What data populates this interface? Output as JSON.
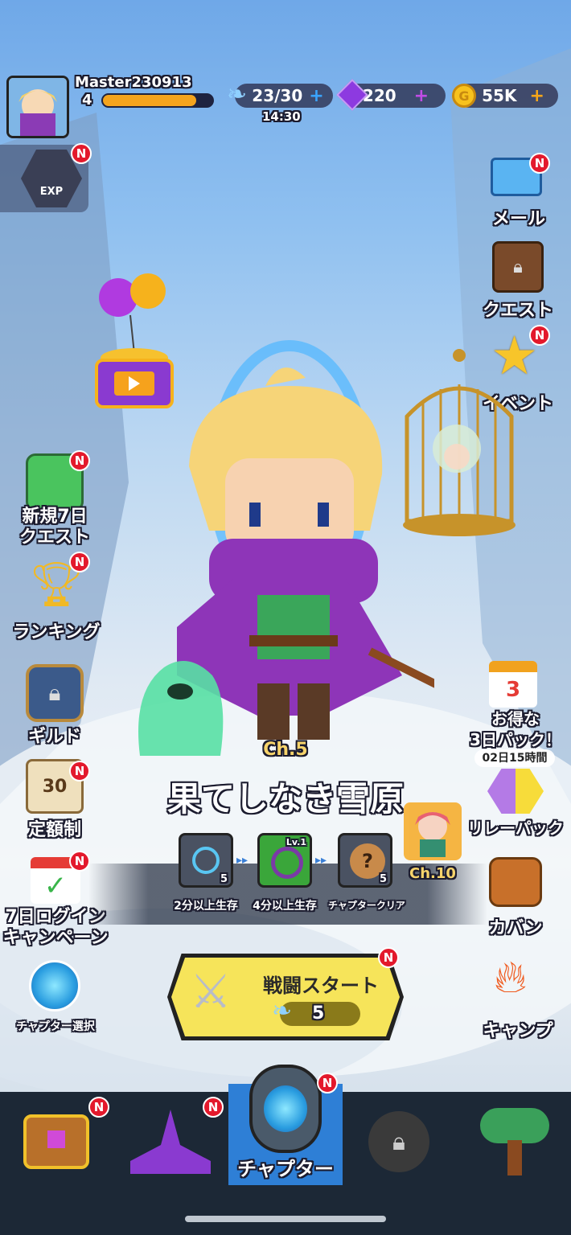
{
  "player": {
    "name": "Master230913",
    "level": "4",
    "exp_fraction": 0.85
  },
  "resources": {
    "energy": "23/30",
    "energy_timer": "14:30",
    "gems": "220",
    "gold": "55K"
  },
  "left_menu": {
    "exp_label": "EXP",
    "new7day_line1": "新規7日",
    "new7day_line2": "クエスト",
    "ranking": "ランキング",
    "guild": "ギルド",
    "subscription": "定額制",
    "subscription_days": "30",
    "login_line1": "7日ログイン",
    "login_line2": "キャンペーン",
    "chapter_select": "チャプター選択"
  },
  "right_menu": {
    "mail": "メール",
    "quest": "クエスト",
    "event": "イベント",
    "deal_line1": "お得な",
    "deal_line2": "3日パック！",
    "deal_calendar": "3",
    "deal_timer": "02日15時間",
    "relay_pack": "リレーパック",
    "bag": "カバン",
    "camp": "キャンプ"
  },
  "chapter": {
    "label": "Ch.5",
    "title": "果てしなき雪原",
    "next_chapter": "Ch.10",
    "rewards": [
      {
        "count": "5",
        "label": "2分以上生存"
      },
      {
        "count": "",
        "level": "Lv.1",
        "label": "4分以上生存"
      },
      {
        "count": "5",
        "label": "チャプタークリア"
      }
    ]
  },
  "battle": {
    "label": "戦闘スタート",
    "cost": "5"
  },
  "nav": {
    "chapter_label": "チャプター"
  },
  "badge_text": "N",
  "colors": {
    "badge": "#e3192c",
    "battle_yellow": "#f6e45a",
    "nav_bg": "#1c2836",
    "nav_active": "#2e7fd6"
  }
}
